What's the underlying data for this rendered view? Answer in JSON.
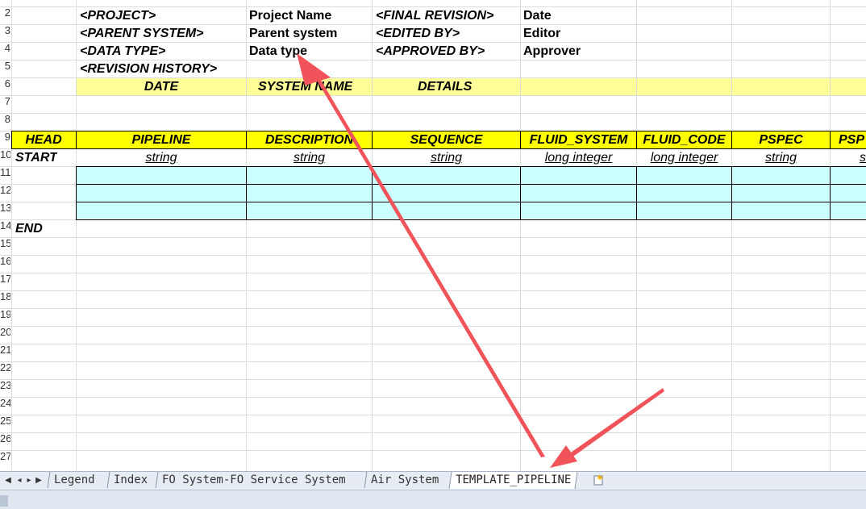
{
  "sheet": {
    "row_numbers": [
      "2",
      "3",
      "4",
      "5",
      "6",
      "7",
      "8",
      "9",
      "10",
      "11",
      "12",
      "13",
      "14",
      "15",
      "16",
      "17",
      "18",
      "19",
      "20",
      "21",
      "22",
      "23",
      "24",
      "25",
      "26",
      "27"
    ],
    "meta": {
      "project_label": "<PROJECT>",
      "project_value": "Project Name",
      "final_revision_label": "<FINAL REVISION>",
      "final_revision_value": "Date",
      "parent_system_label": "<PARENT SYSTEM>",
      "parent_system_value": "Parent system",
      "edited_by_label": "<EDITED BY>",
      "edited_by_value": "Editor",
      "data_type_label": "<DATA TYPE>",
      "data_type_value": "Data type",
      "approved_by_label": "<APPROVED BY>",
      "approved_by_value": "Approver",
      "revision_history_label": "<REVISION HISTORY>"
    },
    "revision_headers": {
      "date": "DATE",
      "system_name": "SYSTEM NAME",
      "details": "DETAILS"
    },
    "head_label": "HEAD",
    "start_label": "START",
    "end_label": "END",
    "columns": [
      {
        "name": "PIPELINE",
        "type": "string"
      },
      {
        "name": "DESCRIPTION",
        "type": "string"
      },
      {
        "name": "SEQUENCE",
        "type": "string"
      },
      {
        "name": "FLUID_SYSTEM",
        "type": "long integer"
      },
      {
        "name": "FLUID_CODE",
        "type": "long integer"
      },
      {
        "name": "PSPEC",
        "type": "string"
      },
      {
        "name": "PSP",
        "type": "s"
      }
    ]
  },
  "tabs": [
    {
      "label": "Legend"
    },
    {
      "label": "Index"
    },
    {
      "label": "FO System-FO Service System"
    },
    {
      "label": "Air System"
    },
    {
      "label": "TEMPLATE_PIPELINE",
      "active": true
    }
  ],
  "colors": {
    "header_yellow": "#ffff00",
    "revision_yellow": "#ffff99",
    "data_cyan": "#ccffff",
    "annotation_arrow": "#f0545a"
  }
}
